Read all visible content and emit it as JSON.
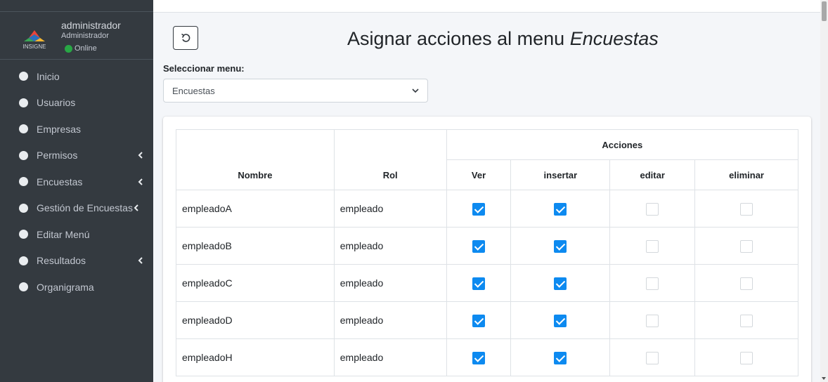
{
  "sidebar": {
    "user": {
      "name": "administrador",
      "role": "Administrador",
      "status": "Online"
    },
    "items": [
      {
        "label": "Inicio",
        "has_submenu": false
      },
      {
        "label": "Usuarios",
        "has_submenu": false
      },
      {
        "label": "Empresas",
        "has_submenu": false
      },
      {
        "label": "Permisos",
        "has_submenu": true
      },
      {
        "label": "Encuestas",
        "has_submenu": true
      },
      {
        "label": "Gestión de Encuestas",
        "has_submenu": true
      },
      {
        "label": "Editar Menú",
        "has_submenu": false
      },
      {
        "label": "Resultados",
        "has_submenu": true
      },
      {
        "label": "Organigrama",
        "has_submenu": false
      }
    ]
  },
  "main": {
    "title_prefix": "Asignar acciones al menu",
    "title_menu": "Encuestas",
    "select_label": "Seleccionar menu:",
    "select_value": "Encuestas",
    "table": {
      "group_header": "Acciones",
      "headers": {
        "nombre": "Nombre",
        "rol": "Rol",
        "ver": "Ver",
        "insertar": "insertar",
        "editar": "editar",
        "eliminar": "eliminar"
      },
      "rows": [
        {
          "nombre": "empleadoA",
          "rol": "empleado",
          "ver": true,
          "insertar": true,
          "editar": false,
          "eliminar": false
        },
        {
          "nombre": "empleadoB",
          "rol": "empleado",
          "ver": true,
          "insertar": true,
          "editar": false,
          "eliminar": false
        },
        {
          "nombre": "empleadoC",
          "rol": "empleado",
          "ver": true,
          "insertar": true,
          "editar": false,
          "eliminar": false
        },
        {
          "nombre": "empleadoD",
          "rol": "empleado",
          "ver": true,
          "insertar": true,
          "editar": false,
          "eliminar": false
        },
        {
          "nombre": "empleadoH",
          "rol": "empleado",
          "ver": true,
          "insertar": true,
          "editar": false,
          "eliminar": false
        }
      ]
    }
  },
  "colors": {
    "sidebar_bg": "#343a40",
    "checkbox_checked": "#0d8af0",
    "status_online": "#28a745"
  }
}
